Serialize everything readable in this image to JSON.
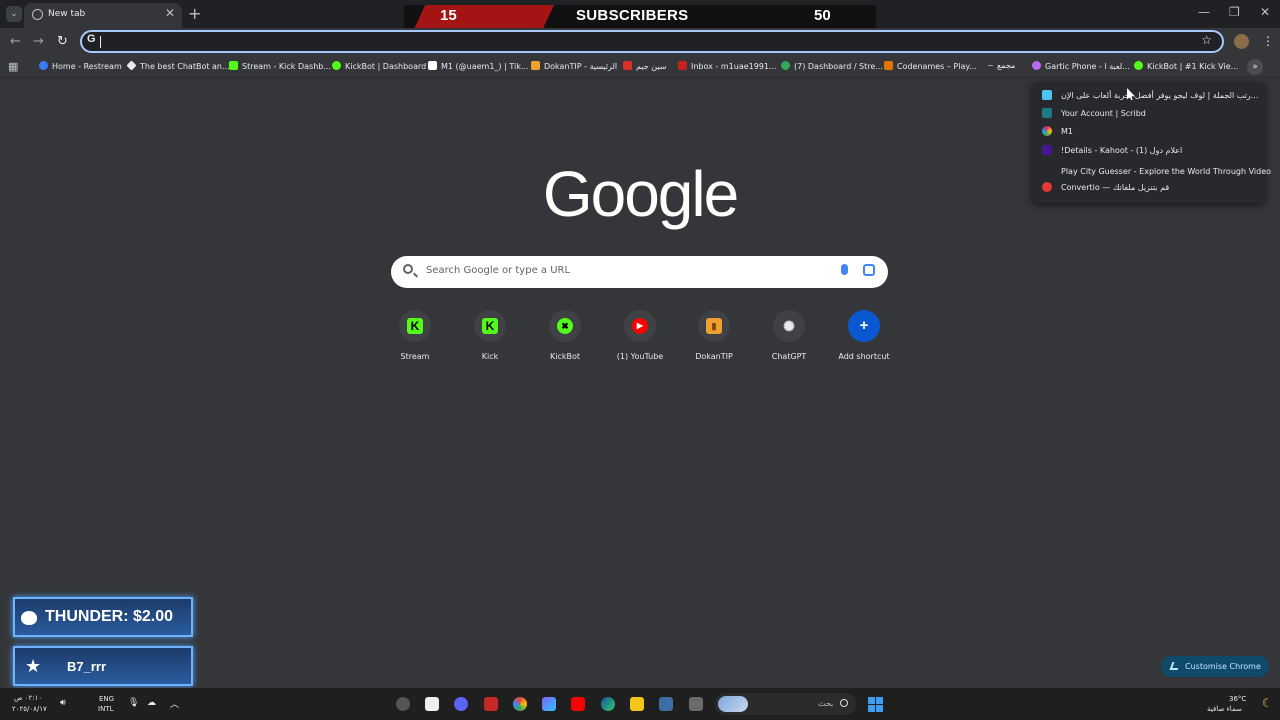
{
  "window": {
    "tab_title": "New tab",
    "new_tab_glyph": "+",
    "controls": [
      "—",
      "❐",
      "✕"
    ]
  },
  "overlay": {
    "current": "15",
    "label": "SUBSCRIBERS",
    "goal": "50",
    "accent": "#a51414"
  },
  "toolbar": {
    "omnibox_value": "",
    "omnibox_icon": "G"
  },
  "bookmarks": [
    {
      "label": "Home - Restream",
      "color": "#3b7bf5"
    },
    {
      "label": "The best ChatBot an...",
      "color": "#e8eaed"
    },
    {
      "label": "Stream - Kick Dashb...",
      "color": "#53fc18"
    },
    {
      "label": "KickBot | Dashboard",
      "color": "#53fc18"
    },
    {
      "label": "M1 (@uaem1_) | Tik...",
      "color": "#ffffff"
    },
    {
      "label": "DokanTIP - الرئيسية",
      "color": "#f0a030"
    },
    {
      "label": "سين جيم",
      "color": "#d93025"
    },
    {
      "label": "Inbox - m1uae1991...",
      "color": "#c5221f"
    },
    {
      "label": "(7) Dashboard / Stre...",
      "color": "#34a853"
    },
    {
      "label": "Codenames – Play...",
      "color": "#e37400"
    },
    {
      "label": "مجمع",
      "color": "#9aa0a6"
    },
    {
      "label": "Gartic Phone - لعبة ا...",
      "color": "#b56cf0"
    },
    {
      "label": "KickBot | #1 Kick Vie...",
      "color": "#53fc18"
    }
  ],
  "overflow_menu": [
    {
      "label": "رتب الجملة | لوف ليجو يوفر أفضل تجربة ألعاب على الإن...",
      "color": "#4fc3f7"
    },
    {
      "label": "Your Account | Scribd",
      "color": "#1e7b85"
    },
    {
      "label": "M1",
      "color": "#e91e63"
    },
    {
      "label": "!Details - Kahoot - (1) اعلام دول",
      "color": "#46178f"
    },
    {
      "label": "Play City Guesser - Explore the World Through Video",
      "color": ""
    },
    {
      "label": "Convertio — قم بتنزيل ملفاتك",
      "color": "#e53935"
    }
  ],
  "logo": "Google",
  "search": {
    "placeholder": "Search Google or type a URL"
  },
  "shortcuts": [
    {
      "label": "Stream",
      "glyph": "K",
      "color": "#53fc18"
    },
    {
      "label": "Kick",
      "glyph": "K",
      "color": "#53fc18"
    },
    {
      "label": "KickBot",
      "glyph": "✖",
      "color": "#53fc18"
    },
    {
      "label": "(1) YouTube",
      "glyph": "▶",
      "color": "#ff0000"
    },
    {
      "label": "DokanTIP",
      "glyph": "▮",
      "color": "#f0a030"
    },
    {
      "label": "ChatGPT",
      "glyph": "✺",
      "color": "#e8eaed"
    },
    {
      "label": "Add shortcut",
      "glyph": "+",
      "color": "#0b57d0"
    }
  ],
  "alerts": {
    "tip": "THUNDER: $2.00",
    "follower": "B7_rrr"
  },
  "customise_label": "Customise Chrome",
  "taskbar": {
    "time": "٠٢:١٠ ص",
    "date": "٢٠٢٥/٠٨/١٧",
    "lang_top": "ENG",
    "lang_bottom": "INTL",
    "search_text": "بحث",
    "temperature": "36°C",
    "weather": "سماء صافية"
  }
}
